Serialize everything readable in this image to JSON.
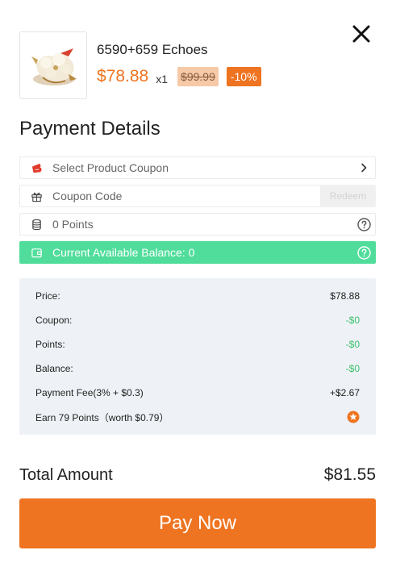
{
  "product": {
    "name": "6590+659 Echoes",
    "price": "$78.88",
    "quantity": "x1",
    "original_price": "$99.99",
    "discount": "-10%"
  },
  "section_title": "Payment Details",
  "coupon_select": {
    "label": "Select Product Coupon",
    "icon": "coupon-ticket-icon"
  },
  "coupon_code": {
    "placeholder": "Coupon Code",
    "value": "",
    "redeem_label": "Redeem",
    "icon": "gift-icon"
  },
  "points": {
    "label": "0 Points",
    "icon": "coin-stack-icon"
  },
  "balance": {
    "label": "Current Available Balance: 0",
    "icon": "wallet-icon"
  },
  "summary": {
    "price_label": "Price:",
    "price_value": "$78.88",
    "coupon_label": "Coupon:",
    "coupon_value": "-$0",
    "points_label": "Points:",
    "points_value": "-$0",
    "balance_label": "Balance:",
    "balance_value": "-$0",
    "fee_label": "Payment Fee(3% + $0.3)",
    "fee_value": "+$2.67",
    "earn_label": "Earn 79 Points（worth $0.79）"
  },
  "total": {
    "label": "Total Amount",
    "value": "$81.55"
  },
  "pay_button": "Pay Now",
  "colors": {
    "accent": "#ee7421",
    "balance_green": "#50dd9b",
    "deduction_green": "#3cbf6c",
    "summary_bg": "#eef2f6"
  }
}
